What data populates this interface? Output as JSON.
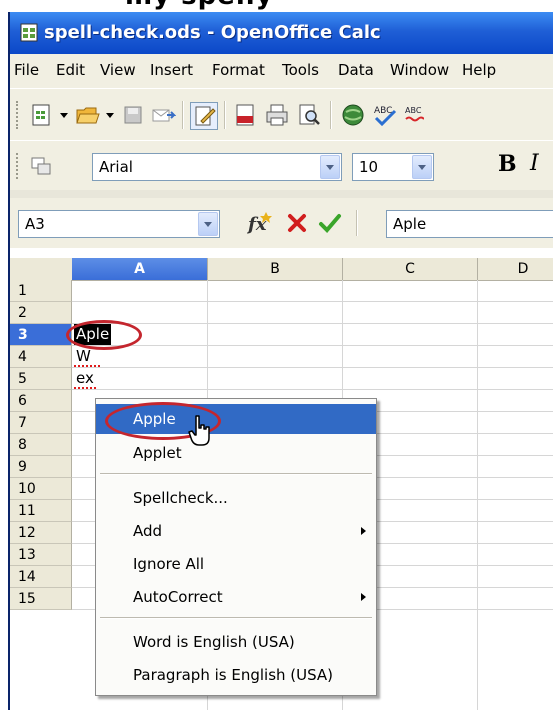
{
  "window": {
    "title": "spell-check.ods - OpenOffice Calc",
    "menu": [
      "File",
      "Edit",
      "View",
      "Insert",
      "Format",
      "Tools",
      "Data",
      "Window",
      "Help"
    ]
  },
  "toolbar": {
    "font_name": "Arial",
    "font_size": "10",
    "bold_label": "B",
    "italic_label": "I"
  },
  "formula_bar": {
    "name_box": "A3",
    "content": "Aple"
  },
  "sheet": {
    "columns": [
      "A",
      "B",
      "C",
      "D"
    ],
    "rows": [
      "1",
      "2",
      "3",
      "4",
      "5",
      "6",
      "7",
      "8",
      "9",
      "10",
      "11",
      "12",
      "13",
      "14",
      "15"
    ],
    "cells": {
      "A3": "Aple",
      "A4": "W",
      "A5": "ex"
    }
  },
  "context_menu": {
    "suggestions": [
      "Apple",
      "Applet"
    ],
    "items": [
      "Spellcheck...",
      "Add",
      "Ignore All",
      "AutoCorrect",
      "Word is English (USA)",
      "Paragraph is English (USA)"
    ]
  }
}
